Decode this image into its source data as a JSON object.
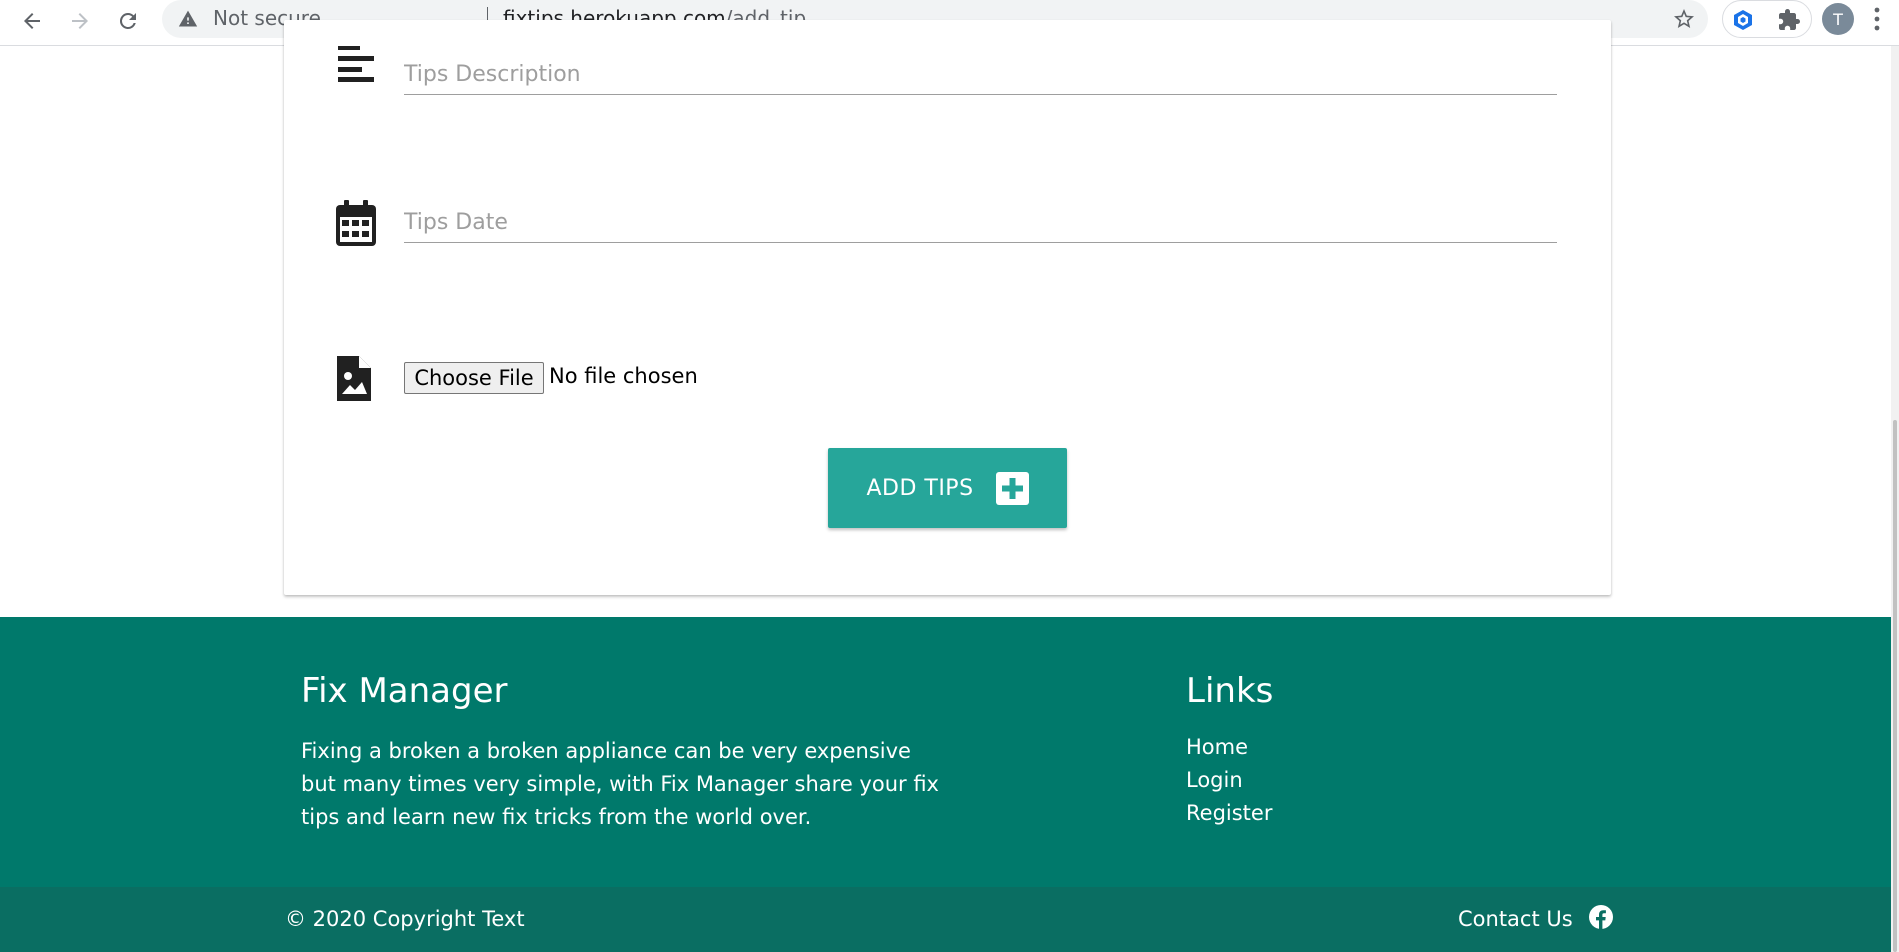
{
  "browser": {
    "security_label": "Not secure",
    "url_host": "fixtips.herokuapp.com",
    "url_path": "/add_tip",
    "avatar_letter": "T"
  },
  "form": {
    "description_placeholder": "Tips Description",
    "date_placeholder": "Tips Date",
    "file_button_label": "Choose File",
    "file_status": "No file chosen",
    "submit_label": "ADD TIPS"
  },
  "footer": {
    "brand_title": "Fix Manager",
    "brand_text": "Fixing a broken a broken appliance can be very expensive but many times very simple, with Fix Manager share your fix tips and learn new fix tricks from the world over.",
    "links_title": "Links",
    "links": [
      {
        "label": "Home"
      },
      {
        "label": "Login"
      },
      {
        "label": "Register"
      }
    ],
    "copyright": "© 2020 Copyright Text",
    "contact_label": "Contact Us"
  },
  "colors": {
    "accent": "#26a69a",
    "footer": "#00796b"
  },
  "icons": {
    "description": "notes-icon",
    "date": "calendar-icon",
    "file": "image-file-icon",
    "submit": "plus-square-icon",
    "social": "facebook-icon"
  }
}
